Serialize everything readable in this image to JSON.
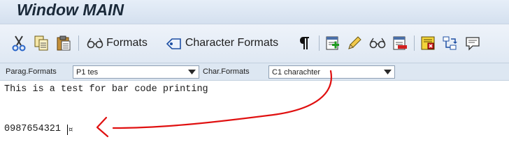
{
  "window": {
    "title": "Window MAIN"
  },
  "toolbar": {
    "formats_label": "Formats",
    "character_formats_label": "Character Formats",
    "icons": [
      "scissors-icon",
      "copy-icon",
      "paste-icon",
      "formats-icon",
      "character-formats-icon",
      "paragraph-mark-icon",
      "insert-command-icon",
      "pencil-icon",
      "glasses-icon",
      "delete-icon",
      "text-element-icon",
      "move-icon",
      "comment-icon"
    ]
  },
  "format_bar": {
    "paragraph_formats_label": "Parag.Formats",
    "paragraph_format_value": "P1 tes",
    "character_formats_label": "Char.Formats",
    "character_format_value": "C1 charachter"
  },
  "editor": {
    "lines": [
      "This is a test for bar code printing",
      "0987654321"
    ],
    "paragraph_mark": "¤"
  },
  "colors": {
    "annotation": "#e01010",
    "title_bar": "#d4e0ef",
    "toolbar": "#e4ecf6"
  }
}
